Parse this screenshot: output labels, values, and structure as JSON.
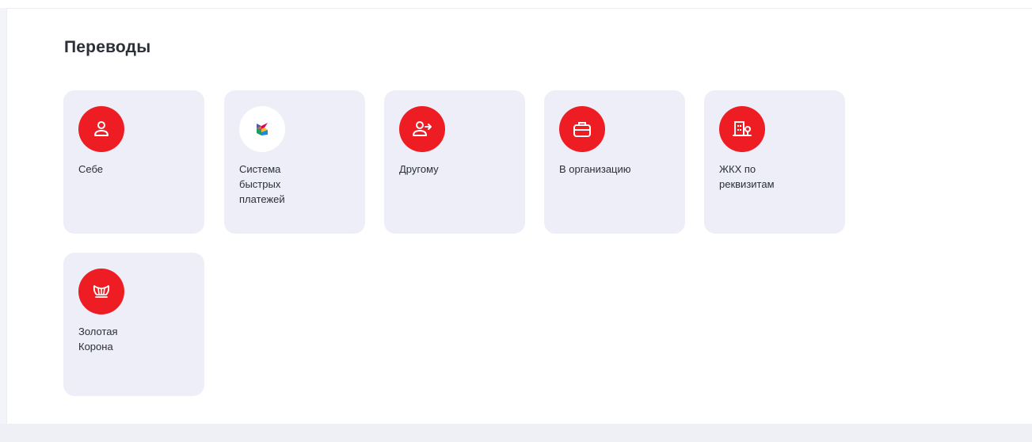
{
  "section": {
    "title": "Переводы"
  },
  "tiles": [
    {
      "label_lines": [
        "Себе"
      ],
      "icon": "person-icon",
      "icon_bg": "#ee1d23"
    },
    {
      "label_lines": [
        "Система",
        "быстрых",
        "платежей"
      ],
      "icon": "sbp-logo-icon",
      "icon_bg": "#ffffff"
    },
    {
      "label_lines": [
        "Другому"
      ],
      "icon": "person-arrow-icon",
      "icon_bg": "#ee1d23"
    },
    {
      "label_lines": [
        "В организацию"
      ],
      "icon": "briefcase-icon",
      "icon_bg": "#ee1d23"
    },
    {
      "label_lines": [
        "ЖКХ по",
        "реквизитам"
      ],
      "icon": "building-icon",
      "icon_bg": "#ee1d23"
    },
    {
      "label_lines": [
        "Золотая",
        "Корона"
      ],
      "icon": "crown-icon",
      "icon_bg": "#ee1d23"
    }
  ],
  "colors": {
    "accent": "#ee1d23",
    "tile_bg": "#edeef7",
    "text": "#2b2f38"
  }
}
